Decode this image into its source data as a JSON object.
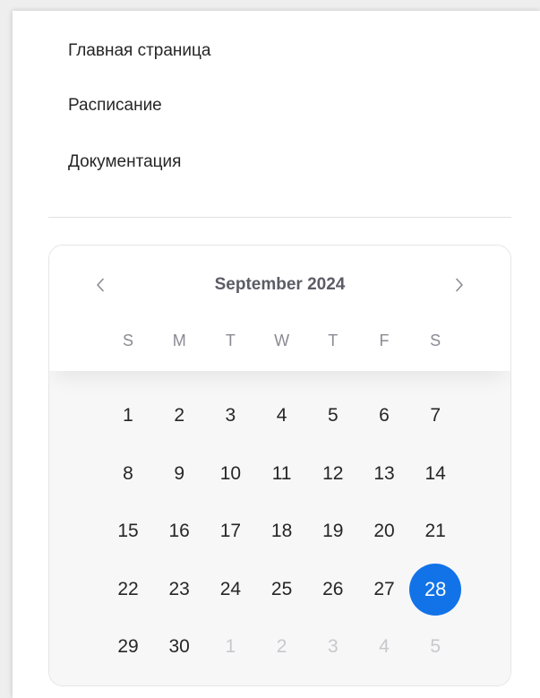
{
  "nav": {
    "links": [
      "Главная страница",
      "Расписание",
      "Документация"
    ]
  },
  "calendar": {
    "month_label": "September 2024",
    "prev_icon": "chevron-left-icon",
    "next_icon": "chevron-right-icon",
    "weekdays": [
      "S",
      "M",
      "T",
      "W",
      "T",
      "F",
      "S"
    ],
    "weeks": [
      [
        {
          "label": "1",
          "muted": false,
          "selected": false
        },
        {
          "label": "2",
          "muted": false,
          "selected": false
        },
        {
          "label": "3",
          "muted": false,
          "selected": false
        },
        {
          "label": "4",
          "muted": false,
          "selected": false
        },
        {
          "label": "5",
          "muted": false,
          "selected": false
        },
        {
          "label": "6",
          "muted": false,
          "selected": false
        },
        {
          "label": "7",
          "muted": false,
          "selected": false
        }
      ],
      [
        {
          "label": "8",
          "muted": false,
          "selected": false
        },
        {
          "label": "9",
          "muted": false,
          "selected": false
        },
        {
          "label": "10",
          "muted": false,
          "selected": false
        },
        {
          "label": "11",
          "muted": false,
          "selected": false
        },
        {
          "label": "12",
          "muted": false,
          "selected": false
        },
        {
          "label": "13",
          "muted": false,
          "selected": false
        },
        {
          "label": "14",
          "muted": false,
          "selected": false
        }
      ],
      [
        {
          "label": "15",
          "muted": false,
          "selected": false
        },
        {
          "label": "16",
          "muted": false,
          "selected": false
        },
        {
          "label": "17",
          "muted": false,
          "selected": false
        },
        {
          "label": "18",
          "muted": false,
          "selected": false
        },
        {
          "label": "19",
          "muted": false,
          "selected": false
        },
        {
          "label": "20",
          "muted": false,
          "selected": false
        },
        {
          "label": "21",
          "muted": false,
          "selected": false
        }
      ],
      [
        {
          "label": "22",
          "muted": false,
          "selected": false
        },
        {
          "label": "23",
          "muted": false,
          "selected": false
        },
        {
          "label": "24",
          "muted": false,
          "selected": false
        },
        {
          "label": "25",
          "muted": false,
          "selected": false
        },
        {
          "label": "26",
          "muted": false,
          "selected": false
        },
        {
          "label": "27",
          "muted": false,
          "selected": false
        },
        {
          "label": "28",
          "muted": false,
          "selected": true
        }
      ],
      [
        {
          "label": "29",
          "muted": false,
          "selected": false
        },
        {
          "label": "30",
          "muted": false,
          "selected": false
        },
        {
          "label": "1",
          "muted": true,
          "selected": false
        },
        {
          "label": "2",
          "muted": true,
          "selected": false
        },
        {
          "label": "3",
          "muted": true,
          "selected": false
        },
        {
          "label": "4",
          "muted": true,
          "selected": false
        },
        {
          "label": "5",
          "muted": true,
          "selected": false
        }
      ]
    ]
  },
  "colors": {
    "accent": "#1273e8",
    "text": "#262626",
    "muted_text": "#c8c8cd",
    "header_text": "#5c5c66"
  }
}
